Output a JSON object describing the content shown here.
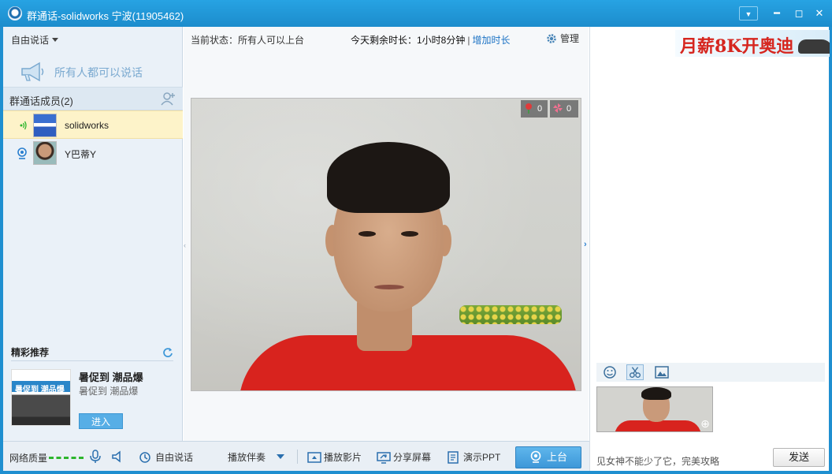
{
  "window": {
    "title": "群通话-solidworks 宁波(11905462)"
  },
  "left": {
    "mode_label": "自由说话",
    "everyone_speak": "所有人都可以说话",
    "members_header": "群通话成员(2)",
    "members": [
      {
        "name": "solidworks",
        "status_icon": "speaking-icon"
      },
      {
        "name": "Y巴蒂Y",
        "status_icon": "camera-icon"
      }
    ],
    "recommend": {
      "header": "精彩推荐",
      "image_text": "暑促到 潮品爆",
      "title": "暑促到 潮品爆",
      "subtitle": "暑促到 潮品爆",
      "enter_label": "进入"
    }
  },
  "center": {
    "current_state": "当前状态：所有人可以上台",
    "remaining_time": "今天剩余时长：1小时8分钟",
    "separator": "|",
    "add_time": "增加时长",
    "manage": "管理",
    "gifts": {
      "flowers": "0",
      "pinwheel": "0"
    }
  },
  "bottom": {
    "net_quality": "网络质量",
    "free_speak": "自由说话",
    "accompaniment": "播放伴奏",
    "play_movie": "播放影片",
    "share_screen": "分享屏幕",
    "ppt": "演示PPT",
    "go_stage": "上台"
  },
  "right": {
    "ad_text": "月薪8K开奥迪",
    "chat_input_text": "见女神不能少了它，完美攻略",
    "send_label": "发送"
  },
  "colors": {
    "titlebar": "#1c8ccc",
    "accent": "#3d97d8",
    "net_good": "#2db52d",
    "ad_red": "#d6261f"
  }
}
